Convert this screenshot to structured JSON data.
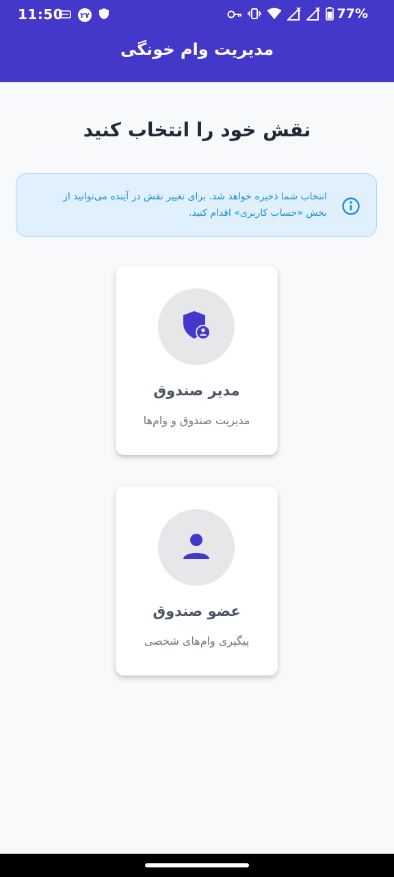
{
  "status_bar": {
    "time": "11:50",
    "notification_badge": "۲۷",
    "battery": "77%",
    "icons": [
      "card-icon",
      "badge-icon",
      "shield-icon",
      "key-icon",
      "vibrate-icon",
      "wifi-icon",
      "signal-icon",
      "signal-icon",
      "battery-icon"
    ]
  },
  "app_bar": {
    "title": "مدیریت وام خونگی"
  },
  "page": {
    "heading": "نقش خود را انتخاب کنید"
  },
  "info": {
    "icon": "info-icon",
    "text": "انتخاب شما ذخیره خواهد شد. برای تغییر نقش در آینده می‌توانید از بخش «حساب کاربری» اقدام کنید."
  },
  "roles": [
    {
      "icon": "shield-person-icon",
      "title": "مدیر صندوق",
      "description": "مدیریت صندوق و وام‌ها"
    },
    {
      "icon": "person-icon",
      "title": "عضو صندوق",
      "description": "پیگیری وام‌های شخصی"
    }
  ],
  "colors": {
    "primary": "#4338ca",
    "background": "#f8f9fb",
    "info_bg": "#e0f1fd",
    "info_text": "#1a8fd6",
    "avatar_bg": "#e7e7ea"
  }
}
